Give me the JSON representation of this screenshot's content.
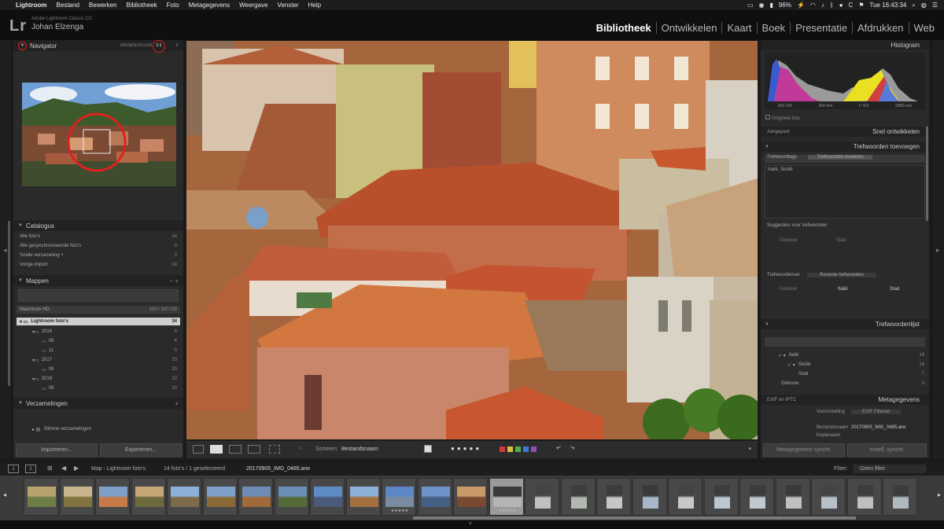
{
  "menubar": {
    "items": [
      "Lightroom",
      "Bestand",
      "Bewerken",
      "Bibliotheek",
      "Foto",
      "Metagegevens",
      "Weergave",
      "Venster",
      "Help"
    ],
    "battery": "96%",
    "clock": "Tue 16:43:34"
  },
  "header": {
    "logo": "Lr",
    "catalog_line": "Adobe Lightroom Classic CC",
    "user_name": "Johan Elzenga",
    "modules": [
      "Bibliotheek",
      "Ontwikkelen",
      "Kaart",
      "Boek",
      "Presentatie",
      "Afdrukken",
      "Web"
    ],
    "active_module": "Bibliotheek"
  },
  "left": {
    "navigator": {
      "title": "Navigator",
      "zoom_fit": "PASSEN",
      "zoom_fill": "VULLEN",
      "zoom_active": "1:1"
    },
    "catalogus": {
      "title": "Catalogus",
      "items": [
        {
          "label": "Alle foto's",
          "count": "14"
        },
        {
          "label": "Alle gesynchroniseerde foto's",
          "count": "0"
        },
        {
          "label": "Snelle verzameling +",
          "count": "0"
        },
        {
          "label": "Vorige import",
          "count": "14"
        }
      ]
    },
    "mappen": {
      "title": "Mappen",
      "volume": {
        "label": "Macintosh HD",
        "info": "100 / 500 GB"
      },
      "root": {
        "label": "Lightroom foto's",
        "count": "34"
      },
      "tree": [
        {
          "label": "2016",
          "count": "4"
        },
        {
          "label": "08",
          "count": "4"
        },
        {
          "label": "11",
          "count": "0"
        },
        {
          "label": "2017",
          "count": "20"
        },
        {
          "label": "09",
          "count": "20"
        },
        {
          "label": "2018",
          "count": "10"
        },
        {
          "label": "08",
          "count": "10"
        }
      ]
    },
    "verzamelingen": {
      "title": "Verzamelingen",
      "items": [
        "Slimme verzamelingen"
      ]
    },
    "import_btn": "Importeren...",
    "export_btn": "Exporteren..."
  },
  "right": {
    "histogram": {
      "title": "Histogram",
      "iso": "ISO 100",
      "focal": "200 mm",
      "aperture": "f / 8.0",
      "shutter": "1/800 sec",
      "original_label": "Originele foto"
    },
    "quick_develop": {
      "preset": "Aangepast",
      "title": "Snel ontwikkelen"
    },
    "keywording": {
      "title": "Trefwoorden toevoegen",
      "tags_label": "Trefwoordtags",
      "tags_value": "Trefwoorden invoeren",
      "keywords_text": "Italië, Sicilië"
    },
    "suggestions": {
      "label": "Suggesties voor trefwoorden",
      "items": [
        "Gebouw",
        "Stad"
      ]
    },
    "keyword_set": {
      "label": "Trefwoordenset",
      "value": "Recente trefwoorden",
      "items": [
        "Gebouw",
        "Italië",
        "Stad"
      ]
    },
    "keyword_list": {
      "title": "Trefwoordenlijst",
      "items": [
        {
          "label": "Italië",
          "count": "14"
        },
        {
          "label": "Sicilië",
          "count": "14"
        },
        {
          "label": "Stad",
          "count": "7"
        },
        {
          "label": "Gebouw",
          "count": "3"
        }
      ]
    },
    "metadata": {
      "preset": "EXIF en IPTC",
      "title": "Metagegevens",
      "preset_label": "Voorinstelling",
      "preset_value": "EXIF Filtered",
      "filename_label": "Bestandsnaam",
      "filename_value": "20170905_IMG_0485.arw",
      "copy_label": "Kopienaam"
    },
    "sync_meta_btn": "Metagegevens synchr.",
    "sync_settings_btn": "Instell. synchr."
  },
  "toolbar": {
    "sort_label": "Sorteren:",
    "sort_value": "Bestandsnaam"
  },
  "filmstrip_bar": {
    "page_a": "1",
    "page_b": "2",
    "source": "Map : Lightroom foto's",
    "count": "14 foto's / 1 geselecteerd",
    "filename": "20170905_IMG_0485.arw",
    "filter_label": "Filter:",
    "filter_value": "Geen filter"
  },
  "filmstrip": {
    "thumb_count": 25,
    "selected_index": 13,
    "ratings": {
      "10": "★★★★★",
      "13": "★★★★★"
    }
  }
}
